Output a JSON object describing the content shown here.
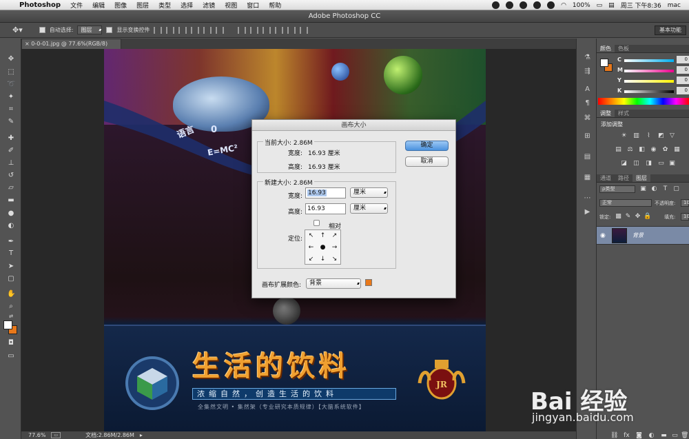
{
  "menubar": {
    "app_name": "Photoshop",
    "items": [
      "文件",
      "编辑",
      "图像",
      "图层",
      "类型",
      "选择",
      "滤镜",
      "视图",
      "窗口",
      "帮助"
    ],
    "battery": "100%",
    "clock": "周三 下午8:36",
    "user": "mac"
  },
  "window": {
    "title": "Adobe Photoshop CC"
  },
  "options_bar": {
    "auto_select_label": "自动选择:",
    "auto_select_value": "图层",
    "show_transform_label": "显示变换控件",
    "workspace_label": "基本功能"
  },
  "document": {
    "tab_label": "0-0-01.jpg @ 77.6%(RGB/8)",
    "artwork_formula": "E=MC²",
    "artwork_text1": "语言",
    "artwork_text2": "0",
    "slogan": "生活的饮料",
    "sub_slogan": "浓缩自然，创造生活的饮料",
    "footnote": "全集然文明 • 集然架（专业研究本质规律）【大脑系统软件】"
  },
  "status_bar": {
    "zoom": "77.6%",
    "doc_size": "文档:2.86M/2.86M"
  },
  "color_panel": {
    "tabs": [
      "颜色",
      "色板"
    ],
    "sliders": [
      {
        "label": "C",
        "value": "0",
        "gradient": "linear-gradient(90deg,#fff,#00aeef)"
      },
      {
        "label": "M",
        "value": "0",
        "gradient": "linear-gradient(90deg,#fff,#ec008c)"
      },
      {
        "label": "Y",
        "value": "0",
        "gradient": "linear-gradient(90deg,#fff,#fff200)"
      },
      {
        "label": "K",
        "value": "0",
        "gradient": "linear-gradient(90deg,#fff,#000)"
      }
    ],
    "foreground": "#ffffff",
    "background": "#e8781a"
  },
  "adjust_panel": {
    "tabs": [
      "调整",
      "样式"
    ],
    "add_label": "添加调整"
  },
  "layers_panel": {
    "tabs": [
      "通道",
      "路径",
      "图层"
    ],
    "filter_label": "ρ类型",
    "blend_mode": "正常",
    "opacity_label": "不透明度:",
    "opacity_value": "10",
    "lock_label": "锁定:",
    "fill_label": "填充:",
    "fill_value": "10",
    "layer_name": "背景"
  },
  "dialog": {
    "title": "画布大小",
    "current_title": "当前大小: 2.86M",
    "current_width_label": "宽度:",
    "current_width_value": "16.93 厘米",
    "current_height_label": "高度:",
    "current_height_value": "16.93 厘米",
    "new_title": "新建大小: 2.86M",
    "width_label": "宽度:",
    "width_value": "16.93",
    "width_unit": "厘米",
    "height_label": "高度:",
    "height_value": "16.93",
    "height_unit": "厘米",
    "relative_label": "相对",
    "anchor_label": "定位:",
    "extension_label": "画布扩展颜色:",
    "extension_value": "背景",
    "ok_label": "确定",
    "cancel_label": "取消",
    "swatch_color": "#e8781a"
  },
  "watermark": {
    "logo": "Bai 经验",
    "url": "jingyan.baidu.com"
  }
}
